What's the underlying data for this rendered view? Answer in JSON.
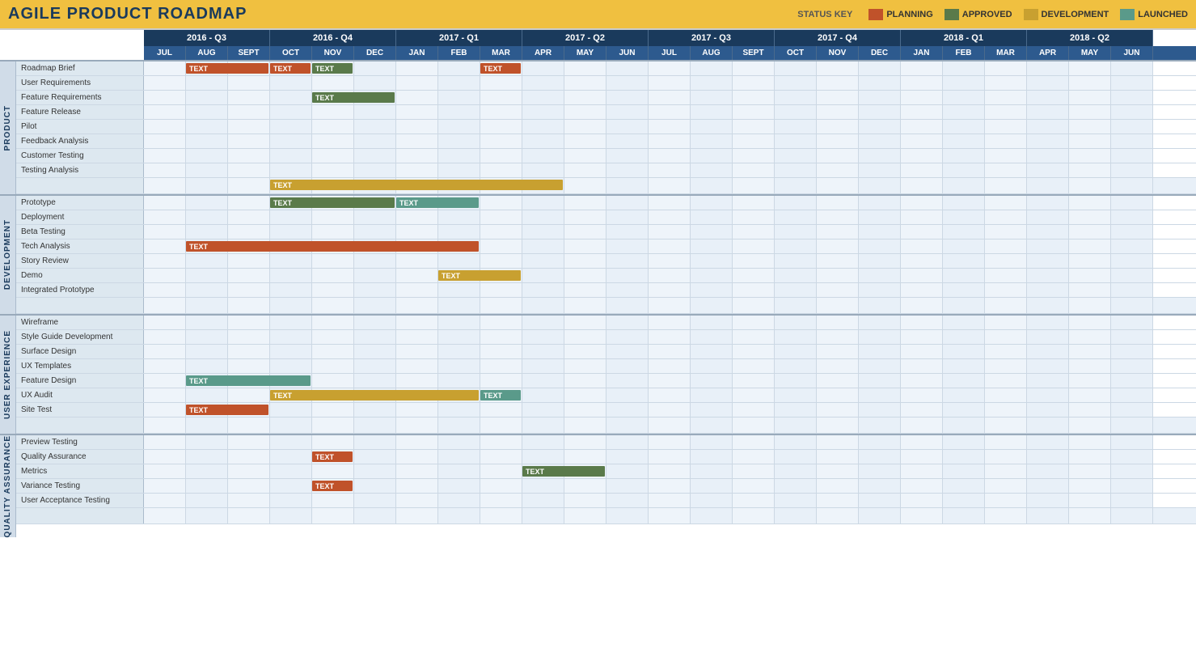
{
  "title": "AGILE PRODUCT ROADMAP",
  "statusKey": {
    "label": "STATUS KEY",
    "items": [
      {
        "label": "PLANNING",
        "color": "#c0522a"
      },
      {
        "label": "APPROVED",
        "color": "#5a7a4a"
      },
      {
        "label": "DEVELOPMENT",
        "color": "#c8a030"
      },
      {
        "label": "LAUNCHED",
        "color": "#5a9a8a"
      }
    ]
  },
  "quarters": [
    {
      "label": "2016 - Q3",
      "months": 3
    },
    {
      "label": "2016 - Q4",
      "months": 3
    },
    {
      "label": "2017 - Q1",
      "months": 3
    },
    {
      "label": "2017 - Q2",
      "months": 3
    },
    {
      "label": "2017 - Q3",
      "months": 3
    },
    {
      "label": "2017 - Q4",
      "months": 3
    },
    {
      "label": "2018 - Q1",
      "months": 3
    },
    {
      "label": "2018 - Q2",
      "months": 3
    }
  ],
  "months": [
    "JUL",
    "AUG",
    "SEPT",
    "OCT",
    "NOV",
    "DEC",
    "JAN",
    "FEB",
    "MAR",
    "APR",
    "MAY",
    "JUN",
    "JUL",
    "AUG",
    "SEPT",
    "OCT",
    "NOV",
    "DEC",
    "JAN",
    "FEB",
    "MAR",
    "APR",
    "MAY",
    "JUN"
  ],
  "sections": [
    {
      "label": "PRODUCT",
      "rows": [
        {
          "label": "Roadmap Brief",
          "bars": [
            {
              "start": 1,
              "width": 2,
              "type": "planning",
              "text": "TEXT"
            },
            {
              "start": 3,
              "width": 1,
              "type": "planning",
              "text": "TEXT"
            },
            {
              "start": 4,
              "width": 1,
              "type": "approved",
              "text": "TEXT"
            },
            {
              "start": 8,
              "width": 1,
              "type": "planning",
              "text": "TEXT"
            }
          ]
        },
        {
          "label": "User Requirements",
          "bars": []
        },
        {
          "label": "Feature Requirements",
          "bars": [
            {
              "start": 4,
              "width": 2,
              "type": "approved",
              "text": "TEXT"
            }
          ]
        },
        {
          "label": "Feature Release",
          "bars": []
        },
        {
          "label": "Pilot",
          "bars": []
        },
        {
          "label": "Feedback Analysis",
          "bars": []
        },
        {
          "label": "Customer Testing",
          "bars": []
        },
        {
          "label": "Testing Analysis",
          "bars": []
        },
        {
          "label": "",
          "bars": [
            {
              "start": 3,
              "width": 7,
              "type": "development",
              "text": "TEXT"
            }
          ],
          "isSummary": true
        }
      ]
    },
    {
      "label": "DEVELOPMENT",
      "rows": [
        {
          "label": "Prototype",
          "bars": [
            {
              "start": 3,
              "width": 3,
              "type": "approved",
              "text": "TEXT"
            },
            {
              "start": 6,
              "width": 2,
              "type": "launched",
              "text": "TEXT"
            }
          ]
        },
        {
          "label": "Deployment",
          "bars": []
        },
        {
          "label": "Beta Testing",
          "bars": []
        },
        {
          "label": "Tech Analysis",
          "bars": [
            {
              "start": 1,
              "width": 7,
              "type": "planning",
              "text": "TEXT"
            }
          ]
        },
        {
          "label": "Story Review",
          "bars": []
        },
        {
          "label": "Demo",
          "bars": [
            {
              "start": 7,
              "width": 2,
              "type": "development",
              "text": "TEXT"
            }
          ]
        },
        {
          "label": "Integrated Prototype",
          "bars": []
        },
        {
          "label": "",
          "bars": [],
          "isSummary": true
        }
      ]
    },
    {
      "label": "USER EXPERIENCE",
      "rows": [
        {
          "label": "Wireframe",
          "bars": []
        },
        {
          "label": "Style Guide Development",
          "bars": []
        },
        {
          "label": "Surface Design",
          "bars": []
        },
        {
          "label": "UX Templates",
          "bars": []
        },
        {
          "label": "Feature Design",
          "bars": [
            {
              "start": 1,
              "width": 3,
              "type": "launched",
              "text": "TEXT"
            }
          ]
        },
        {
          "label": "UX Audit",
          "bars": [
            {
              "start": 3,
              "width": 5,
              "type": "development",
              "text": "TEXT"
            },
            {
              "start": 8,
              "width": 1,
              "type": "launched",
              "text": "TEXT"
            }
          ]
        },
        {
          "label": "Site Test",
          "bars": [
            {
              "start": 1,
              "width": 2,
              "type": "planning",
              "text": "TEXT"
            }
          ]
        },
        {
          "label": "",
          "bars": [],
          "isSummary": true
        }
      ]
    },
    {
      "label": "QUALITY ASSURANCE",
      "rows": [
        {
          "label": "Preview Testing",
          "bars": []
        },
        {
          "label": "Quality Assurance",
          "bars": [
            {
              "start": 4,
              "width": 1,
              "type": "planning",
              "text": "TEXT"
            }
          ]
        },
        {
          "label": "Metrics",
          "bars": [
            {
              "start": 9,
              "width": 2,
              "type": "approved",
              "text": "TEXT"
            }
          ]
        },
        {
          "label": "Variance Testing",
          "bars": [
            {
              "start": 4,
              "width": 1,
              "type": "planning",
              "text": "TEXT"
            }
          ]
        },
        {
          "label": "User Acceptance Testing",
          "bars": []
        },
        {
          "label": "",
          "bars": [],
          "isSummary": true
        }
      ]
    }
  ]
}
